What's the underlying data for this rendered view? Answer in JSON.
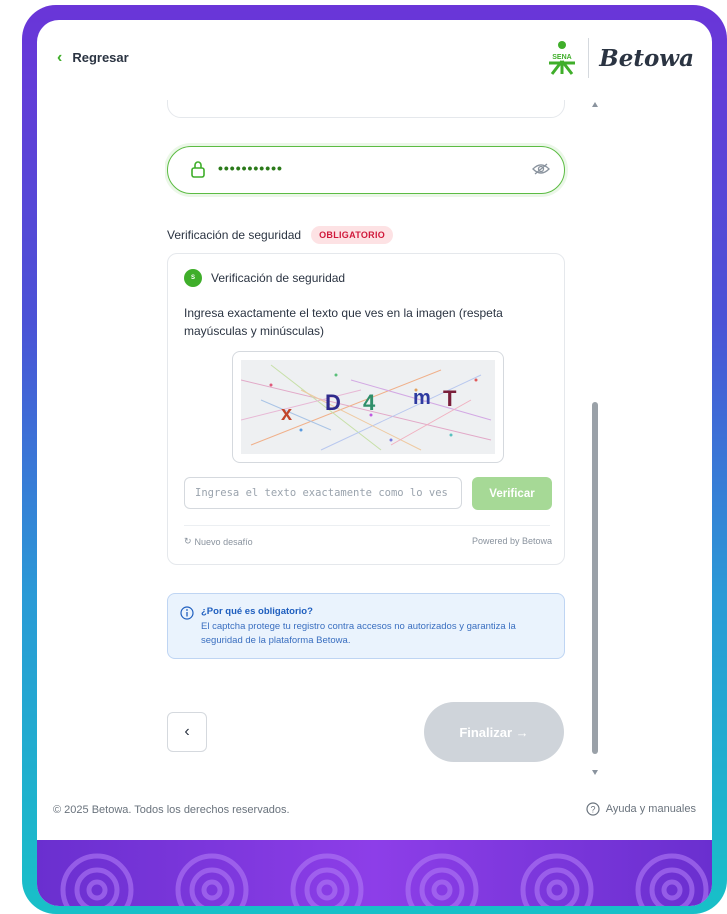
{
  "header": {
    "back_label": "Regresar",
    "brand": "Betowa",
    "sena_text": "SENA"
  },
  "password": {
    "masked": "•••••••••••"
  },
  "security": {
    "section_label": "Verificación de seguridad",
    "badge": "OBLIGATORIO",
    "card_title": "Verificación de seguridad",
    "instruction": "Ingresa exactamente el texto que ves en la imagen (respeta mayúsculas y minúsculas)",
    "captcha_chars": [
      "x",
      "D",
      "4",
      "m",
      "T"
    ],
    "input_placeholder": "Ingresa el texto exactamente como lo ves",
    "verify_label": "Verificar",
    "new_challenge": "Nuevo desafío",
    "powered_by": "Powered by Betowa"
  },
  "info": {
    "question": "¿Por qué es obligatorio?",
    "text": "El captcha protege tu registro contra accesos no autorizados y garantiza la seguridad de la plataforma Betowa."
  },
  "nav": {
    "prev_symbol": "‹",
    "finish_label": "Finalizar →"
  },
  "footer": {
    "copyright": "© 2025 Betowa. Todos los derechos reservados.",
    "help": "Ayuda y manuales"
  },
  "colors": {
    "accent": "#3fae2a",
    "badge": "#d0193b",
    "info": "#1f5fbf",
    "frame": "#6a35d8"
  }
}
